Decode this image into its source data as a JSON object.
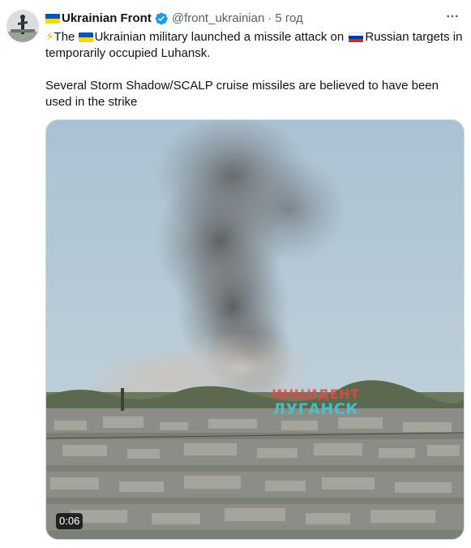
{
  "author": {
    "name": "Ukrainian Front",
    "handle": "@front_ukrainian",
    "separator": "·",
    "time": "5 год"
  },
  "tweet": {
    "line1_bolt": "⚡",
    "line1_a": "The ",
    "line1_b": "Ukrainian military launched a missile attack on ",
    "line1_c": "Russian targets in temporarily occupied Luhansk.",
    "paragraph2": "Several Storm Shadow/SCALP cruise missiles are believed to have been used in the strike"
  },
  "media": {
    "duration": "0:06",
    "watermark_line1": "ИНЦИДЕНТ",
    "watermark_line2": "ЛУГАНСК"
  },
  "icons": {
    "verified": "verified-badge-icon",
    "more": "more-options-icon",
    "flag_ukraine": "flag-ukraine-icon",
    "flag_russia": "flag-russia-icon",
    "bolt": "lightning-icon"
  },
  "colors": {
    "verified": "#1d9bf0",
    "secondary_text": "#536471",
    "ua_blue": "#0057b7",
    "ua_yellow": "#ffd700"
  }
}
